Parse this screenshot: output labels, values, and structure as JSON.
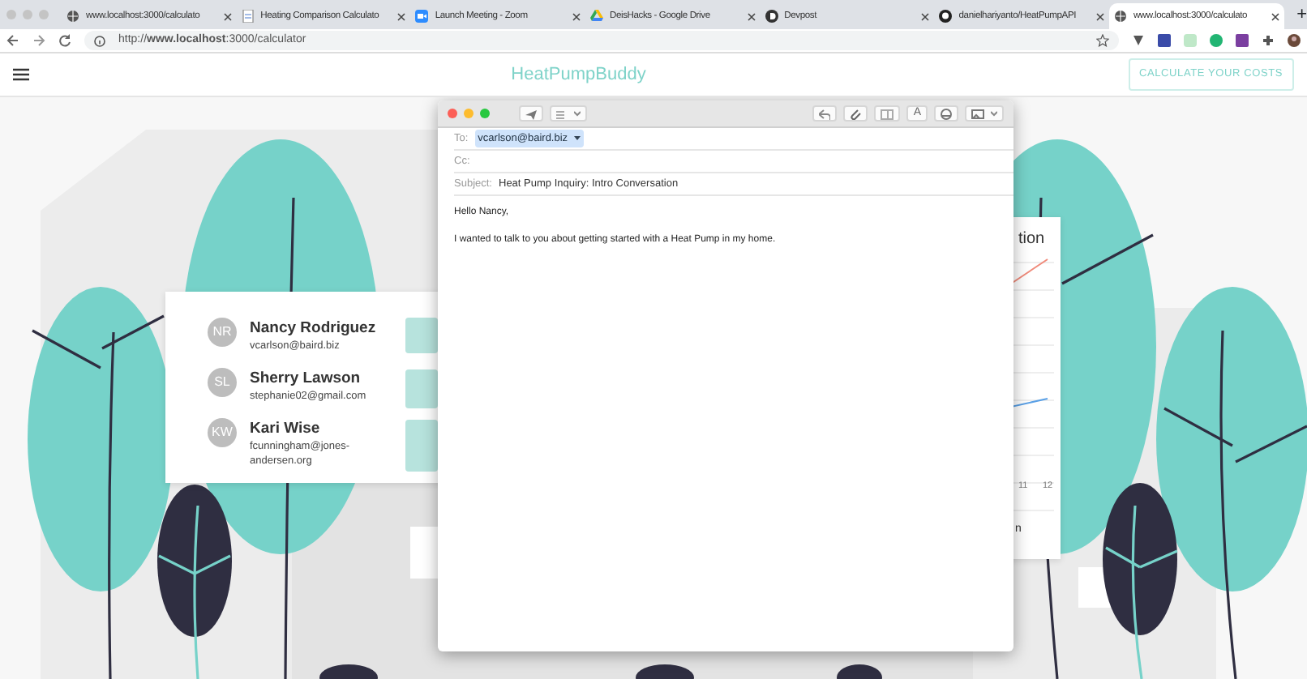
{
  "browser": {
    "tabs": [
      {
        "title": "www.localhost:3000/calculato",
        "kind": "globe",
        "selected": false
      },
      {
        "title": "Heating Comparison Calculato",
        "kind": "doc",
        "selected": false
      },
      {
        "title": "Launch Meeting - Zoom",
        "kind": "zoom",
        "selected": false
      },
      {
        "title": "DeisHacks - Google Drive",
        "kind": "drive",
        "selected": false
      },
      {
        "title": "Devpost",
        "kind": "devpost",
        "selected": false
      },
      {
        "title": "danielhariyanto/HeatPumpAPI",
        "kind": "github",
        "selected": false
      },
      {
        "title": "www.localhost:3000/calculato",
        "kind": "globe",
        "selected": true
      }
    ],
    "new_tab": "+",
    "address": "http://**www.localhost**:3000/calculator"
  },
  "app": {
    "brand": "HeatPumpBuddy",
    "cta": "CALCULATE YOUR COSTS"
  },
  "contacts": [
    {
      "initials": "NR",
      "name": "Nancy Rodriguez",
      "email": "vcarlson@baird.biz"
    },
    {
      "initials": "SL",
      "name": "Sherry Lawson",
      "email": "stephanie02@gmail.com"
    },
    {
      "initials": "KW",
      "name": "Kari Wise",
      "email": "fcunningham@jones-andersen.org"
    }
  ],
  "chart_card": {
    "title": "tion",
    "x_labels": [
      "11",
      "12"
    ],
    "footer": "n"
  },
  "email": {
    "format_button": "A",
    "to_label": "To:",
    "to": "vcarlson@baird.biz",
    "cc_label": "Cc:",
    "subject_label": "Subject:",
    "subject": "Heat Pump Inquiry: Intro Conversation",
    "body": [
      "Hello Nancy,",
      "I wanted to talk to you about getting started with a Heat Pump in my home."
    ]
  }
}
